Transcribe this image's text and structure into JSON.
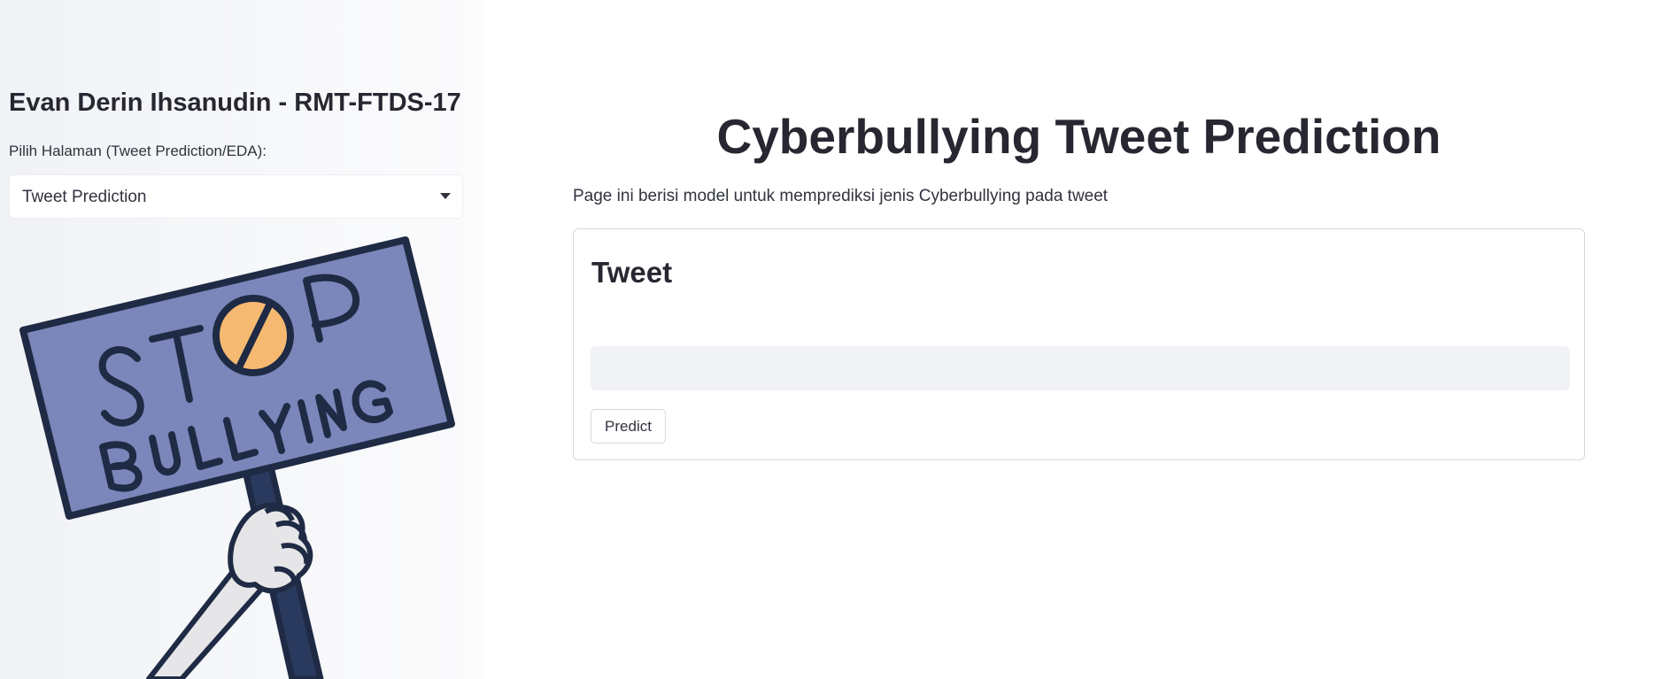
{
  "sidebar": {
    "author": "Evan Derin Ihsanudin - RMT-FTDS-17",
    "select_label": "Pilih Halaman (Tweet Prediction/EDA):",
    "select_value": "Tweet Prediction",
    "illustration": {
      "icon": "stop-bullying-sign",
      "text_top": "ST P",
      "text_bottom": "BULLYING"
    }
  },
  "main": {
    "title": "Cyberbullying Tweet Prediction",
    "description": "Page ini berisi model untuk memprediksi jenis Cyberbullying pada tweet",
    "form": {
      "heading": "Tweet",
      "input_value": "",
      "button_label": "Predict"
    }
  },
  "colors": {
    "sidebar_bg": "#f0f2f6",
    "text": "#262730",
    "input_bg": "#f0f2f6",
    "sign_board": "#7b86ba",
    "sign_outline": "#1f2a44",
    "stop_circle": "#f5b971",
    "hand": "#e8e8ea"
  }
}
